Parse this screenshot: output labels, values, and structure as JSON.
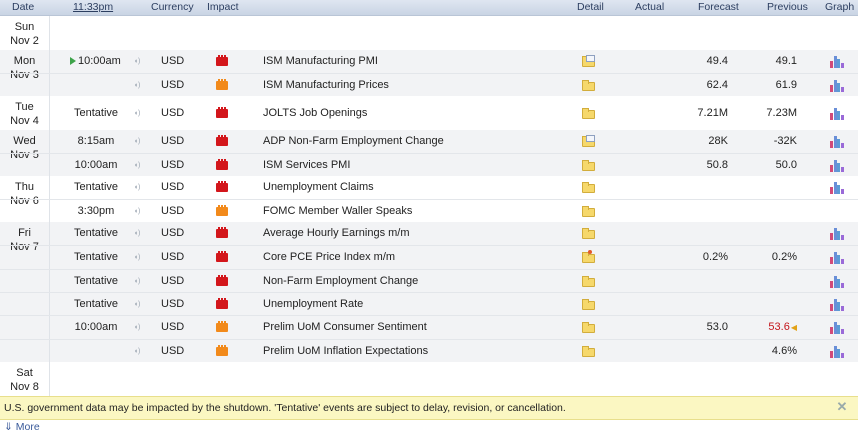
{
  "header": {
    "date": "Date",
    "time": "11:33pm",
    "currency": "Currency",
    "impact": "Impact",
    "detail": "Detail",
    "actual": "Actual",
    "forecast": "Forecast",
    "previous": "Previous",
    "graph": "Graph"
  },
  "days": [
    {
      "day": "Sun",
      "date": "Nov 2"
    },
    {
      "day": "Mon",
      "date": "Nov 3"
    },
    {
      "day": "Tue",
      "date": "Nov 4"
    },
    {
      "day": "Wed",
      "date": "Nov 5"
    },
    {
      "day": "Thu",
      "date": "Nov 6"
    },
    {
      "day": "Fri",
      "date": "Nov 7"
    },
    {
      "day": "Sat",
      "date": "Nov 8"
    }
  ],
  "events": [
    {
      "time": "10:00am",
      "currency": "USD",
      "impact": "high",
      "event": "ISM Manufacturing PMI",
      "detail": "doc",
      "actual": "",
      "forecast": "49.4",
      "previous": "49.1",
      "graph": true
    },
    {
      "time": "",
      "currency": "USD",
      "impact": "med",
      "event": "ISM Manufacturing Prices",
      "detail": "plain",
      "actual": "",
      "forecast": "62.4",
      "previous": "61.9",
      "graph": true
    },
    {
      "time": "Tentative",
      "currency": "USD",
      "impact": "high",
      "event": "JOLTS Job Openings",
      "detail": "plain",
      "actual": "",
      "forecast": "7.21M",
      "previous": "7.23M",
      "graph": true
    },
    {
      "time": "8:15am",
      "currency": "USD",
      "impact": "high",
      "event": "ADP Non-Farm Employment Change",
      "detail": "doc",
      "actual": "",
      "forecast": "28K",
      "previous": "-32K",
      "graph": true
    },
    {
      "time": "10:00am",
      "currency": "USD",
      "impact": "high",
      "event": "ISM Services PMI",
      "detail": "plain",
      "actual": "",
      "forecast": "50.8",
      "previous": "50.0",
      "graph": true
    },
    {
      "time": "Tentative",
      "currency": "USD",
      "impact": "high",
      "event": "Unemployment Claims",
      "detail": "plain",
      "actual": "",
      "forecast": "",
      "previous": "",
      "graph": true
    },
    {
      "time": "3:30pm",
      "currency": "USD",
      "impact": "med",
      "event": "FOMC Member Waller Speaks",
      "detail": "plain",
      "actual": "",
      "forecast": "",
      "previous": "",
      "graph": false
    },
    {
      "time": "Tentative",
      "currency": "USD",
      "impact": "high",
      "event": "Average Hourly Earnings m/m",
      "detail": "plain",
      "actual": "",
      "forecast": "",
      "previous": "",
      "graph": true
    },
    {
      "time": "Tentative",
      "currency": "USD",
      "impact": "high",
      "event": "Core PCE Price Index m/m",
      "detail": "alert",
      "actual": "",
      "forecast": "0.2%",
      "previous": "0.2%",
      "graph": true
    },
    {
      "time": "Tentative",
      "currency": "USD",
      "impact": "high",
      "event": "Non-Farm Employment Change",
      "detail": "plain",
      "actual": "",
      "forecast": "",
      "previous": "",
      "graph": true
    },
    {
      "time": "Tentative",
      "currency": "USD",
      "impact": "high",
      "event": "Unemployment Rate",
      "detail": "plain",
      "actual": "",
      "forecast": "",
      "previous": "",
      "graph": true
    },
    {
      "time": "10:00am",
      "currency": "USD",
      "impact": "med",
      "event": "Prelim UoM Consumer Sentiment",
      "detail": "plain",
      "actual": "",
      "forecast": "53.0",
      "previous": "53.6",
      "graph": true
    },
    {
      "time": "",
      "currency": "USD",
      "impact": "med",
      "event": "Prelim UoM Inflation Expectations",
      "detail": "plain",
      "actual": "",
      "forecast": "",
      "previous": "4.6%",
      "graph": true
    }
  ],
  "notice": "U.S. government data may be impacted by the shutdown. 'Tentative' events are subject to delay, revision, or cancellation.",
  "more": "More",
  "colors": {
    "high_impact": "#d3161b",
    "medium_impact": "#f28a1b",
    "revised": "#c4161c",
    "play": "#3da34a"
  },
  "icons": [
    "play-icon",
    "alert-bell-icon",
    "impact-icon",
    "detail-folder-icon",
    "graph-icon",
    "close-icon",
    "more-arrow-icon"
  ]
}
